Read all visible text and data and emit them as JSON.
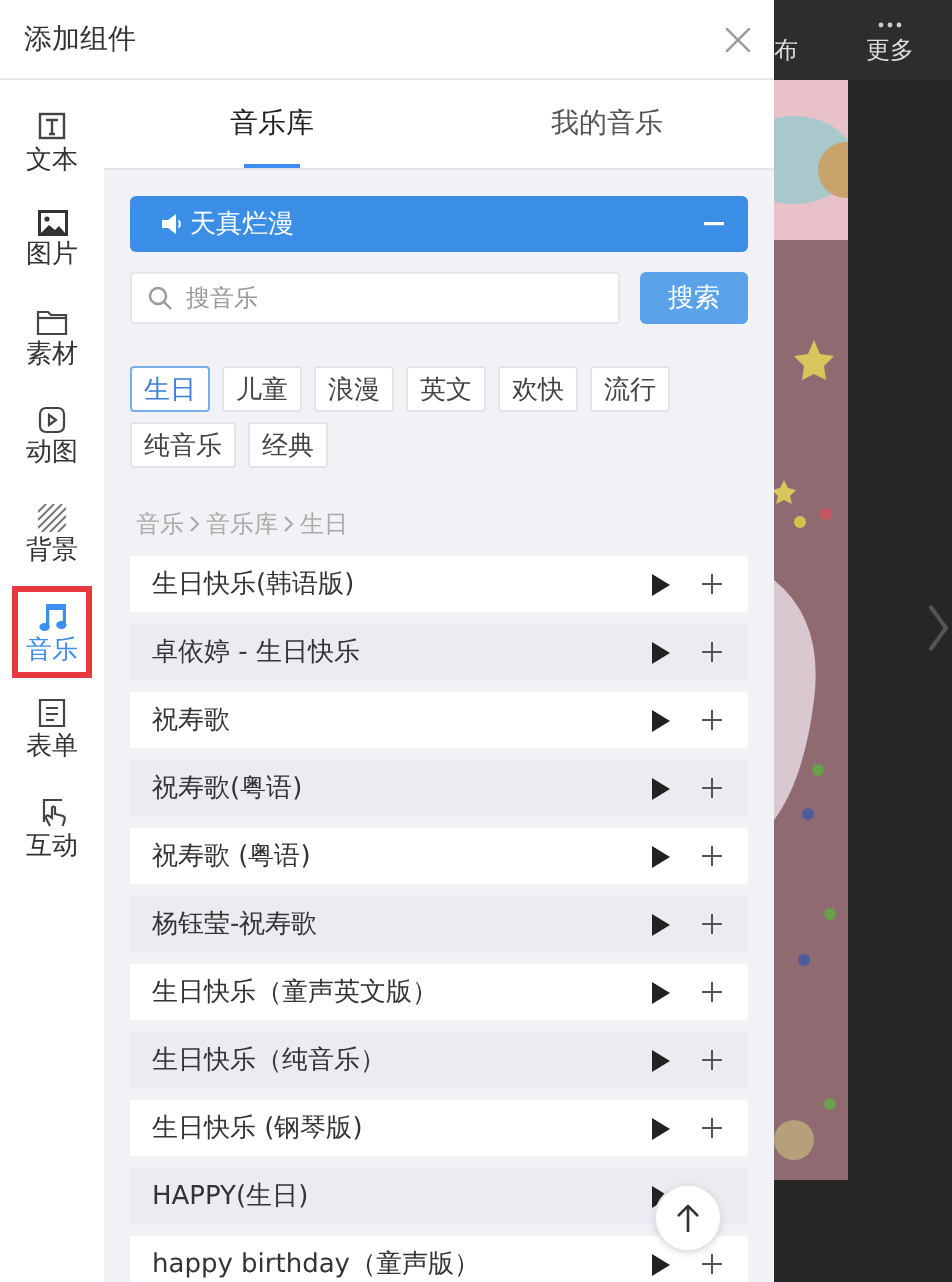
{
  "dialog": {
    "title": "添加组件"
  },
  "sidebar": {
    "items": [
      {
        "label": "文本",
        "selected": false
      },
      {
        "label": "图片",
        "selected": false
      },
      {
        "label": "素材",
        "selected": false
      },
      {
        "label": "动图",
        "selected": false
      },
      {
        "label": "背景",
        "selected": false
      },
      {
        "label": "音乐",
        "selected": true
      },
      {
        "label": "表单",
        "selected": false
      },
      {
        "label": "互动",
        "selected": false
      }
    ]
  },
  "tabs": [
    {
      "label": "音乐库",
      "selected": true
    },
    {
      "label": "我的音乐",
      "selected": false
    }
  ],
  "now_playing": {
    "title": "天真烂漫"
  },
  "search": {
    "placeholder": "搜音乐",
    "button": "搜索"
  },
  "tags": [
    {
      "label": "生日",
      "selected": true
    },
    {
      "label": "儿童",
      "selected": false
    },
    {
      "label": "浪漫",
      "selected": false
    },
    {
      "label": "英文",
      "selected": false
    },
    {
      "label": "欢快",
      "selected": false
    },
    {
      "label": "流行",
      "selected": false
    },
    {
      "label": "纯音乐",
      "selected": false
    },
    {
      "label": "经典",
      "selected": false
    }
  ],
  "breadcrumb": [
    "音乐",
    "音乐库",
    "生日"
  ],
  "songs": [
    {
      "title": "生日快乐(韩语版)"
    },
    {
      "title": "卓依婷 - 生日快乐"
    },
    {
      "title": "祝寿歌"
    },
    {
      "title": "祝寿歌(粤语)"
    },
    {
      "title": "祝寿歌 (粤语)"
    },
    {
      "title": "杨钰莹-祝寿歌"
    },
    {
      "title": "生日快乐（童声英文版）"
    },
    {
      "title": "生日快乐（纯音乐）"
    },
    {
      "title": "生日快乐 (钢琴版)"
    },
    {
      "title": "HAPPY(生日)",
      "add_button": false
    },
    {
      "title": "happy birthday（童声版）"
    }
  ],
  "editor": {
    "toolbar": [
      {
        "label": "布"
      },
      {
        "label": "更多"
      }
    ]
  }
}
